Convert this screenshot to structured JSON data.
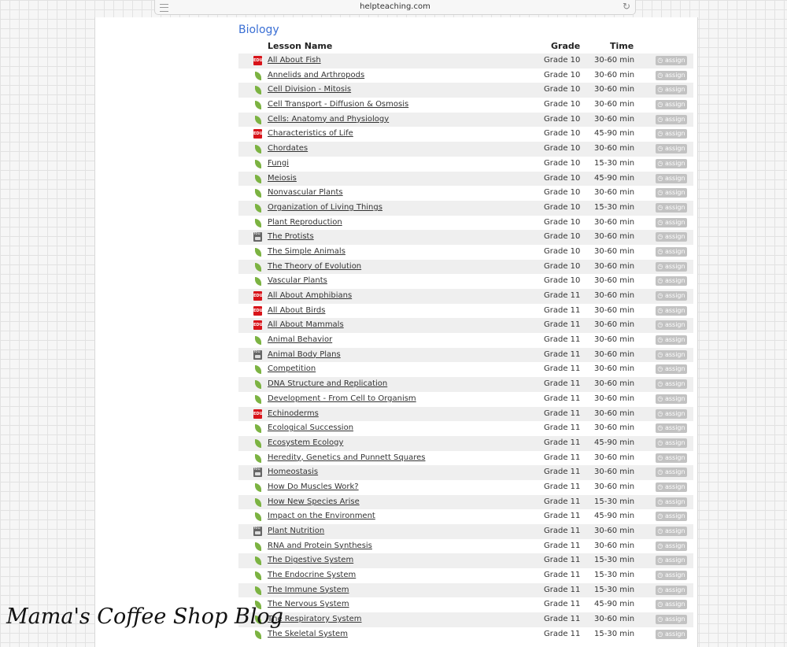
{
  "browser": {
    "url": "helpteaching.com"
  },
  "section_title": "Biology",
  "columns": {
    "name": "Lesson Name",
    "grade": "Grade",
    "time": "Time"
  },
  "assign_label": "assign",
  "lessons": [
    {
      "icon": "edu-icon",
      "name": "All About Fish",
      "grade": "Grade 10",
      "time": "30-60 min"
    },
    {
      "icon": "leaf-icon",
      "name": "Annelids and Arthropods",
      "grade": "Grade 10",
      "time": "30-60 min"
    },
    {
      "icon": "leaf-icon",
      "name": "Cell Division - Mitosis",
      "grade": "Grade 10",
      "time": "30-60 min"
    },
    {
      "icon": "leaf-icon",
      "name": "Cell Transport - Diffusion & Osmosis",
      "grade": "Grade 10",
      "time": "30-60 min"
    },
    {
      "icon": "leaf-icon",
      "name": "Cells: Anatomy and Physiology",
      "grade": "Grade 10",
      "time": "30-60 min"
    },
    {
      "icon": "edu-icon",
      "name": "Characteristics of Life",
      "grade": "Grade 10",
      "time": "45-90 min"
    },
    {
      "icon": "leaf-icon",
      "name": "Chordates",
      "grade": "Grade 10",
      "time": "30-60 min"
    },
    {
      "icon": "leaf-icon",
      "name": "Fungi",
      "grade": "Grade 10",
      "time": "15-30 min"
    },
    {
      "icon": "leaf-icon",
      "name": "Meiosis",
      "grade": "Grade 10",
      "time": "45-90 min"
    },
    {
      "icon": "leaf-icon",
      "name": "Nonvascular Plants",
      "grade": "Grade 10",
      "time": "30-60 min"
    },
    {
      "icon": "leaf-icon",
      "name": "Organization of Living Things",
      "grade": "Grade 10",
      "time": "15-30 min"
    },
    {
      "icon": "leaf-icon",
      "name": "Plant Reproduction",
      "grade": "Grade 10",
      "time": "30-60 min"
    },
    {
      "icon": "youtube-icon",
      "name": "The Protists",
      "grade": "Grade 10",
      "time": "30-60 min"
    },
    {
      "icon": "leaf-icon",
      "name": "The Simple Animals",
      "grade": "Grade 10",
      "time": "30-60 min"
    },
    {
      "icon": "leaf-icon",
      "name": "The Theory of Evolution",
      "grade": "Grade 10",
      "time": "30-60 min"
    },
    {
      "icon": "leaf-icon",
      "name": "Vascular Plants",
      "grade": "Grade 10",
      "time": "30-60 min"
    },
    {
      "icon": "edu-icon",
      "name": "All About Amphibians",
      "grade": "Grade 11",
      "time": "30-60 min"
    },
    {
      "icon": "edu-icon",
      "name": "All About Birds",
      "grade": "Grade 11",
      "time": "30-60 min"
    },
    {
      "icon": "edu-icon",
      "name": "All About Mammals",
      "grade": "Grade 11",
      "time": "30-60 min"
    },
    {
      "icon": "leaf-icon",
      "name": "Animal Behavior",
      "grade": "Grade 11",
      "time": "30-60 min"
    },
    {
      "icon": "youtube-icon",
      "name": "Animal Body Plans",
      "grade": "Grade 11",
      "time": "30-60 min"
    },
    {
      "icon": "leaf-icon",
      "name": "Competition",
      "grade": "Grade 11",
      "time": "30-60 min"
    },
    {
      "icon": "leaf-icon",
      "name": "DNA Structure and Replication",
      "grade": "Grade 11",
      "time": "30-60 min"
    },
    {
      "icon": "leaf-icon",
      "name": "Development - From Cell to Organism",
      "grade": "Grade 11",
      "time": "30-60 min"
    },
    {
      "icon": "edu-icon",
      "name": "Echinoderms",
      "grade": "Grade 11",
      "time": "30-60 min"
    },
    {
      "icon": "leaf-icon",
      "name": "Ecological Succession",
      "grade": "Grade 11",
      "time": "30-60 min"
    },
    {
      "icon": "leaf-icon",
      "name": "Ecosystem Ecology",
      "grade": "Grade 11",
      "time": "45-90 min"
    },
    {
      "icon": "leaf-icon",
      "name": "Heredity, Genetics and Punnett Squares",
      "grade": "Grade 11",
      "time": "30-60 min"
    },
    {
      "icon": "youtube-icon",
      "name": "Homeostasis",
      "grade": "Grade 11",
      "time": "30-60 min"
    },
    {
      "icon": "leaf-icon",
      "name": "How Do Muscles Work?",
      "grade": "Grade 11",
      "time": "30-60 min"
    },
    {
      "icon": "leaf-icon",
      "name": "How New Species Arise",
      "grade": "Grade 11",
      "time": "15-30 min"
    },
    {
      "icon": "leaf-icon",
      "name": "Impact on the Environment",
      "grade": "Grade 11",
      "time": "45-90 min"
    },
    {
      "icon": "youtube-icon",
      "name": "Plant Nutrition",
      "grade": "Grade 11",
      "time": "30-60 min"
    },
    {
      "icon": "leaf-icon",
      "name": "RNA and Protein Synthesis",
      "grade": "Grade 11",
      "time": "30-60 min"
    },
    {
      "icon": "leaf-icon",
      "name": "The Digestive System",
      "grade": "Grade 11",
      "time": "15-30 min"
    },
    {
      "icon": "leaf-icon",
      "name": "The Endocrine System",
      "grade": "Grade 11",
      "time": "15-30 min"
    },
    {
      "icon": "leaf-icon",
      "name": "The Immune System",
      "grade": "Grade 11",
      "time": "15-30 min"
    },
    {
      "icon": "leaf-icon",
      "name": "The Nervous System",
      "grade": "Grade 11",
      "time": "45-90 min"
    },
    {
      "icon": "leaf-icon",
      "name": "The Respiratory System",
      "grade": "Grade 11",
      "time": "30-60 min"
    },
    {
      "icon": "leaf-icon",
      "name": "The Skeletal System",
      "grade": "Grade 11",
      "time": "15-30 min"
    }
  ],
  "watermark": "Mama's Coffee Shop Blog",
  "colors": {
    "title": "#3a6fd4",
    "edu": "#d8141a",
    "leaf": "#7cb342",
    "assign_bg": "#c2c2c2",
    "row_alt": "#efefef"
  }
}
